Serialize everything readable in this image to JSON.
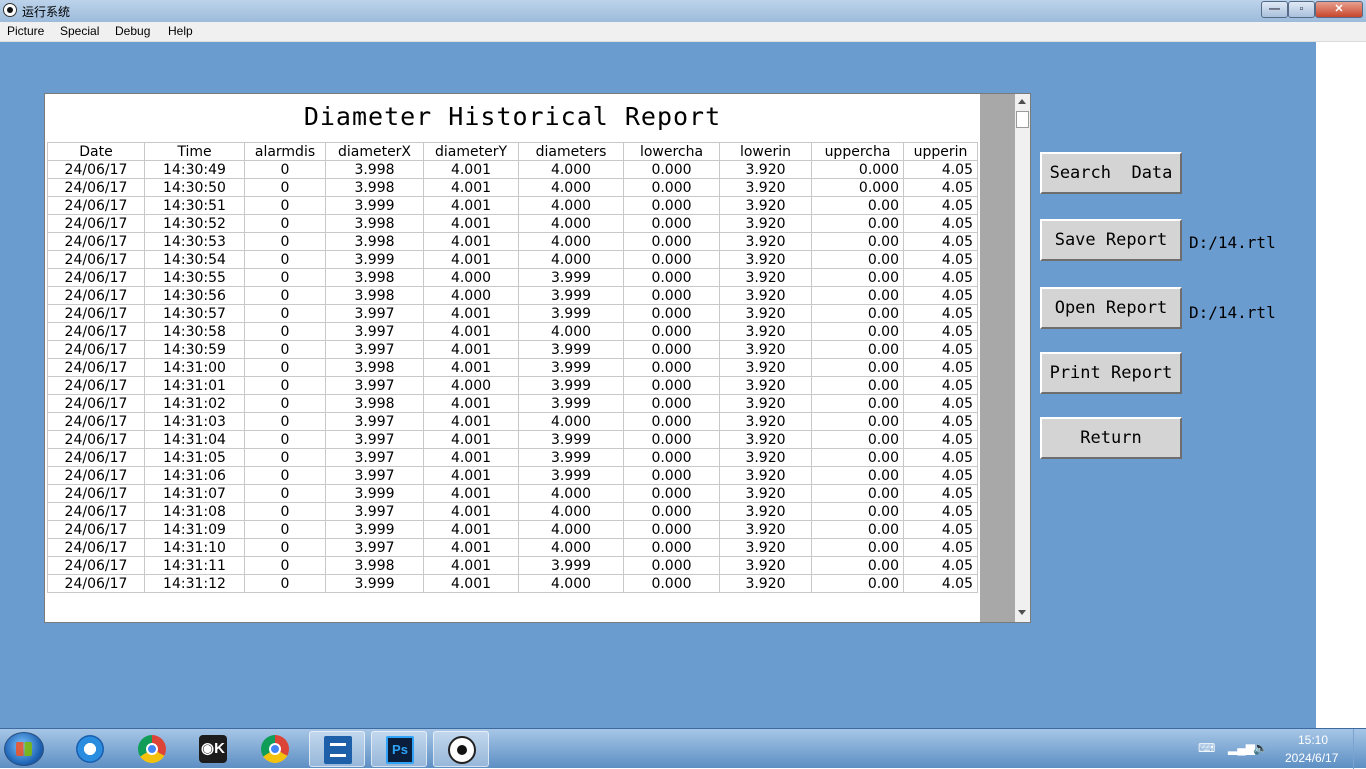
{
  "window": {
    "title": "运行系统",
    "min_glyph": "—",
    "max_glyph": "▫",
    "close_glyph": "✕"
  },
  "menu": [
    {
      "label": "Picture"
    },
    {
      "label": "Special"
    },
    {
      "label": "Debug"
    },
    {
      "label": "Help"
    }
  ],
  "report": {
    "title": "Diameter Historical Report",
    "columns": [
      "Date",
      "Time",
      "alarmdis",
      "diameterX",
      "diameterY",
      "diameters",
      "lowercha",
      "lowerin",
      "uppercha",
      "upperin"
    ],
    "rows": [
      [
        "24/06/17",
        "14:30:49",
        "0",
        "3.998",
        "4.001",
        "4.000",
        "0.000",
        "3.920",
        "0.000",
        "4.05"
      ],
      [
        "24/06/17",
        "14:30:50",
        "0",
        "3.998",
        "4.001",
        "4.000",
        "0.000",
        "3.920",
        "0.000",
        "4.05"
      ],
      [
        "24/06/17",
        "14:30:51",
        "0",
        "3.999",
        "4.001",
        "4.000",
        "0.000",
        "3.920",
        "0.00",
        "4.05"
      ],
      [
        "24/06/17",
        "14:30:52",
        "0",
        "3.998",
        "4.001",
        "4.000",
        "0.000",
        "3.920",
        "0.00",
        "4.05"
      ],
      [
        "24/06/17",
        "14:30:53",
        "0",
        "3.998",
        "4.001",
        "4.000",
        "0.000",
        "3.920",
        "0.00",
        "4.05"
      ],
      [
        "24/06/17",
        "14:30:54",
        "0",
        "3.999",
        "4.001",
        "4.000",
        "0.000",
        "3.920",
        "0.00",
        "4.05"
      ],
      [
        "24/06/17",
        "14:30:55",
        "0",
        "3.998",
        "4.000",
        "3.999",
        "0.000",
        "3.920",
        "0.00",
        "4.05"
      ],
      [
        "24/06/17",
        "14:30:56",
        "0",
        "3.998",
        "4.000",
        "3.999",
        "0.000",
        "3.920",
        "0.00",
        "4.05"
      ],
      [
        "24/06/17",
        "14:30:57",
        "0",
        "3.997",
        "4.001",
        "3.999",
        "0.000",
        "3.920",
        "0.00",
        "4.05"
      ],
      [
        "24/06/17",
        "14:30:58",
        "0",
        "3.997",
        "4.001",
        "4.000",
        "0.000",
        "3.920",
        "0.00",
        "4.05"
      ],
      [
        "24/06/17",
        "14:30:59",
        "0",
        "3.997",
        "4.001",
        "3.999",
        "0.000",
        "3.920",
        "0.00",
        "4.05"
      ],
      [
        "24/06/17",
        "14:31:00",
        "0",
        "3.998",
        "4.001",
        "3.999",
        "0.000",
        "3.920",
        "0.00",
        "4.05"
      ],
      [
        "24/06/17",
        "14:31:01",
        "0",
        "3.997",
        "4.000",
        "3.999",
        "0.000",
        "3.920",
        "0.00",
        "4.05"
      ],
      [
        "24/06/17",
        "14:31:02",
        "0",
        "3.998",
        "4.001",
        "3.999",
        "0.000",
        "3.920",
        "0.00",
        "4.05"
      ],
      [
        "24/06/17",
        "14:31:03",
        "0",
        "3.997",
        "4.001",
        "4.000",
        "0.000",
        "3.920",
        "0.00",
        "4.05"
      ],
      [
        "24/06/17",
        "14:31:04",
        "0",
        "3.997",
        "4.001",
        "3.999",
        "0.000",
        "3.920",
        "0.00",
        "4.05"
      ],
      [
        "24/06/17",
        "14:31:05",
        "0",
        "3.997",
        "4.001",
        "3.999",
        "0.000",
        "3.920",
        "0.00",
        "4.05"
      ],
      [
        "24/06/17",
        "14:31:06",
        "0",
        "3.997",
        "4.001",
        "3.999",
        "0.000",
        "3.920",
        "0.00",
        "4.05"
      ],
      [
        "24/06/17",
        "14:31:07",
        "0",
        "3.999",
        "4.001",
        "4.000",
        "0.000",
        "3.920",
        "0.00",
        "4.05"
      ],
      [
        "24/06/17",
        "14:31:08",
        "0",
        "3.997",
        "4.001",
        "4.000",
        "0.000",
        "3.920",
        "0.00",
        "4.05"
      ],
      [
        "24/06/17",
        "14:31:09",
        "0",
        "3.999",
        "4.001",
        "4.000",
        "0.000",
        "3.920",
        "0.00",
        "4.05"
      ],
      [
        "24/06/17",
        "14:31:10",
        "0",
        "3.997",
        "4.001",
        "4.000",
        "0.000",
        "3.920",
        "0.00",
        "4.05"
      ],
      [
        "24/06/17",
        "14:31:11",
        "0",
        "3.998",
        "4.001",
        "3.999",
        "0.000",
        "3.920",
        "0.00",
        "4.05"
      ],
      [
        "24/06/17",
        "14:31:12",
        "0",
        "3.999",
        "4.001",
        "4.000",
        "0.000",
        "3.920",
        "0.00",
        "4.05"
      ]
    ]
  },
  "buttons": {
    "search": "Search  Data",
    "save": "Save Report",
    "open": "Open Report",
    "print": "Print Report",
    "return": "Return"
  },
  "paths": {
    "save": "D:/14.rtl",
    "open": "D:/14.rtl"
  },
  "taskbar": {
    "apps": [
      {
        "icon": "internet-explorer-icon"
      },
      {
        "icon": "chrome-icon"
      },
      {
        "icon": "obs-icon",
        "glyph": "◉K"
      },
      {
        "icon": "chrome-icon"
      },
      {
        "icon": "editor-icon"
      },
      {
        "icon": "photoshop-icon",
        "glyph": "Ps"
      },
      {
        "icon": "eye-icon"
      }
    ],
    "clock_time": "15:10",
    "clock_date": "2024/6/17"
  },
  "colors": {
    "client_bg": "#6b9ccf",
    "button_face": "#d4d4d4",
    "scroll_block": "#a8a8a8"
  }
}
